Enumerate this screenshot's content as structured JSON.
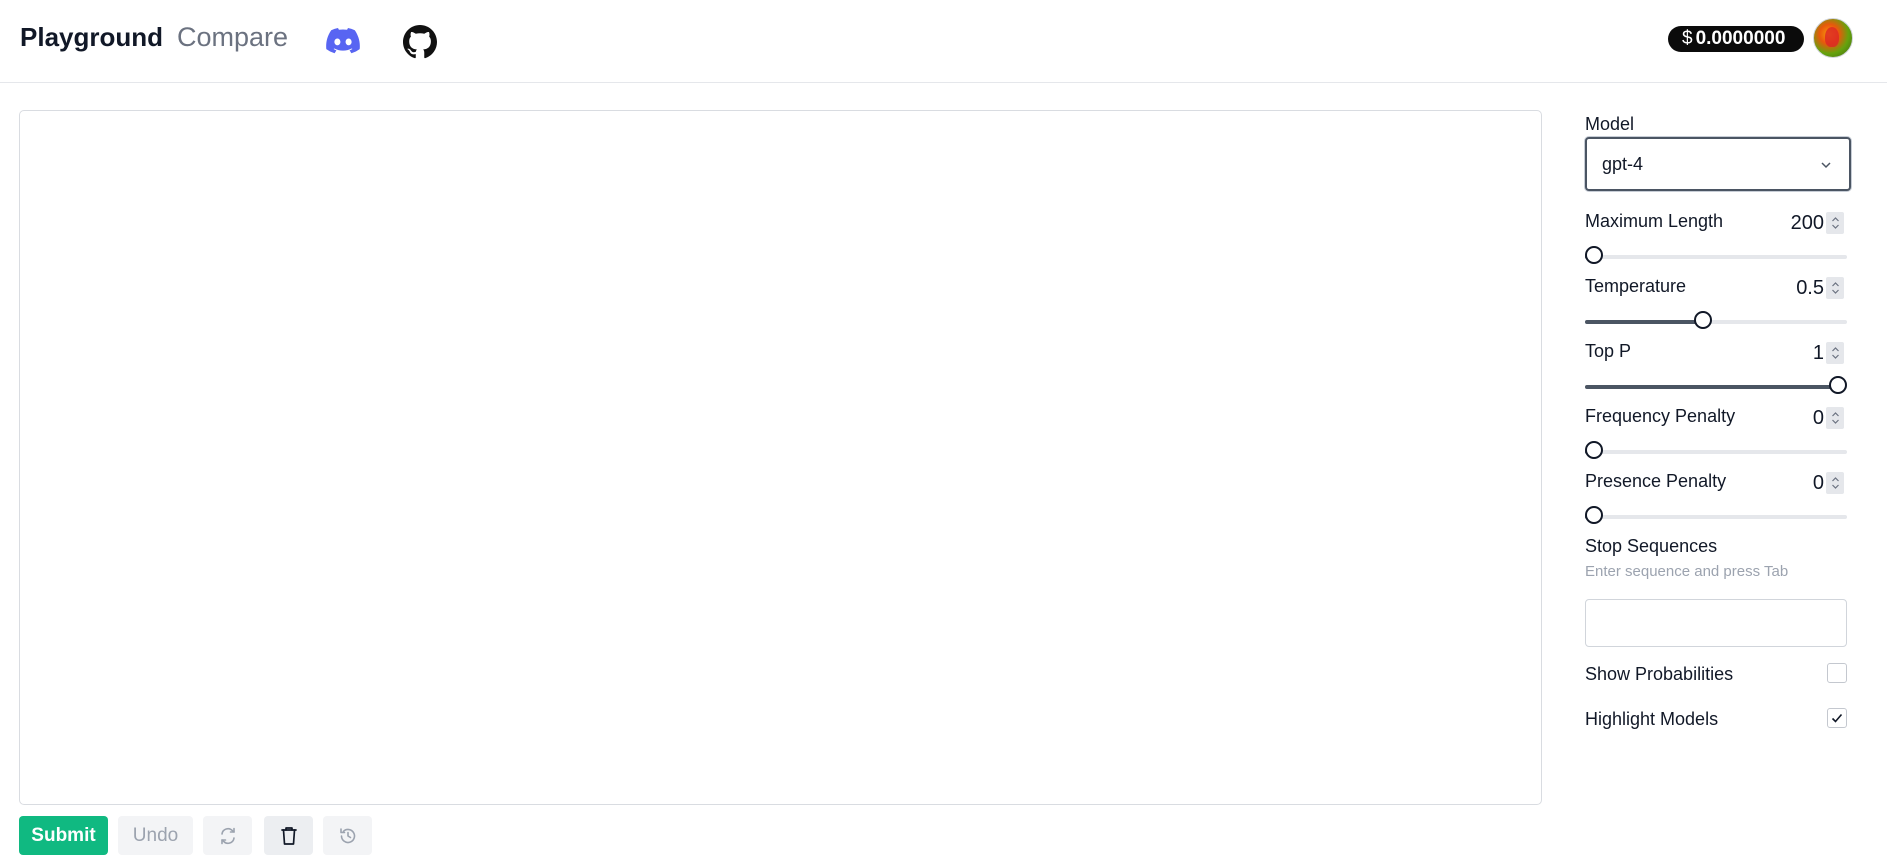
{
  "header": {
    "title": "Playground",
    "compare_label": "Compare",
    "balance": "0.0000000",
    "balance_symbol": "$",
    "icons": [
      "discord-icon",
      "github-icon"
    ]
  },
  "editor": {
    "content": ""
  },
  "actions": {
    "submit_label": "Submit",
    "undo_label": "Undo",
    "icons": [
      "regenerate-icon",
      "trash-icon",
      "history-icon"
    ]
  },
  "settings": {
    "model_label": "Model",
    "model_value": "gpt-4",
    "max_length": {
      "label": "Maximum Length",
      "value": "200",
      "fraction": 0.03
    },
    "temperature": {
      "label": "Temperature",
      "value": "0.5",
      "fraction": 0.45
    },
    "top_p": {
      "label": "Top P",
      "value": "1",
      "fraction": 1.0
    },
    "frequency_penalty": {
      "label": "Frequency Penalty",
      "value": "0",
      "fraction": 0.0
    },
    "presence_penalty": {
      "label": "Presence Penalty",
      "value": "0",
      "fraction": 0.0
    },
    "stop_sequences": {
      "label": "Stop Sequences",
      "hint": "Enter sequence and press Tab",
      "value": ""
    },
    "show_probabilities": {
      "label": "Show Probabilities",
      "checked": false
    },
    "highlight_models": {
      "label": "Highlight Models",
      "checked": true
    }
  },
  "colors": {
    "accent": "#10b981",
    "discord": "#5865f2",
    "slider_fill": "#4b5563"
  }
}
